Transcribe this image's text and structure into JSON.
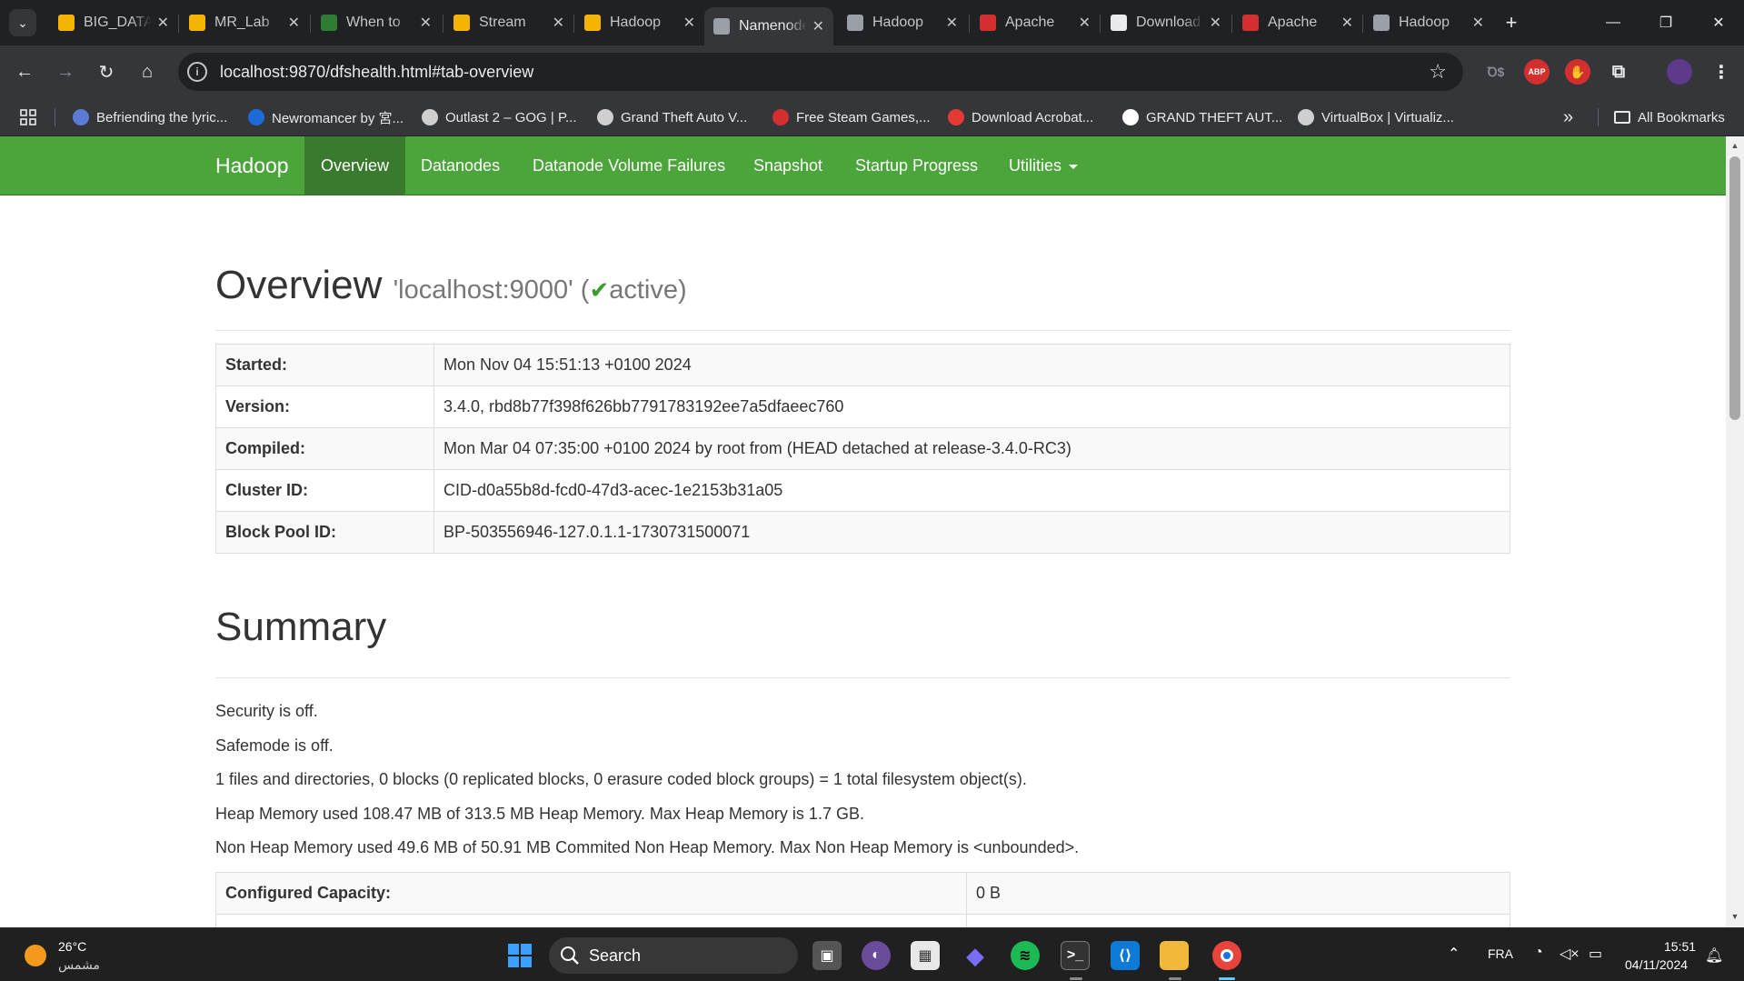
{
  "browser": {
    "tabs": [
      {
        "title": "BIG_DATA",
        "icon": "slides-icon",
        "color": "#f4b400",
        "active": false
      },
      {
        "title": "MR_Lab",
        "icon": "slides-icon",
        "color": "#f4b400",
        "active": false
      },
      {
        "title": "When to",
        "icon": "link-icon",
        "color": "#2e7d32",
        "active": false
      },
      {
        "title": "Stream",
        "icon": "classroom-icon",
        "color": "#f4b400",
        "active": false
      },
      {
        "title": "Hadoop",
        "icon": "slides-icon",
        "color": "#f4b400",
        "active": false
      },
      {
        "title": "Namenode",
        "icon": "globe-icon",
        "color": "#9aa0a6",
        "active": true
      },
      {
        "title": "Hadoop",
        "icon": "chatgpt-icon",
        "color": "#9aa0a6",
        "active": false
      },
      {
        "title": "Apache",
        "icon": "apache-feather-icon",
        "color": "#d32f2f",
        "active": false
      },
      {
        "title": "Download",
        "icon": "download-icon",
        "color": "#e8eaed",
        "active": false
      },
      {
        "title": "Apache",
        "icon": "apache-feather-icon",
        "color": "#d32f2f",
        "active": false
      },
      {
        "title": "Hadoop",
        "icon": "chatgpt-icon",
        "color": "#9aa0a6",
        "active": false
      }
    ],
    "url": "localhost:9870/dfshealth.html#tab-overview",
    "extensions": [
      {
        "name": "translate-extension-icon",
        "label": "Ꝺ$"
      },
      {
        "name": "adblock-plus-icon",
        "label": "ABP"
      },
      {
        "name": "ublock-hand-icon",
        "label": "✋"
      },
      {
        "name": "puzzle-extensions-icon",
        "label": "⧉"
      }
    ],
    "bookmarks": [
      {
        "label": "Befriending the lyric...",
        "color": "#5b7bd5"
      },
      {
        "label": "Newromancer by 宮...",
        "color": "#1e6ad8"
      },
      {
        "label": "Outlast 2 – GOG | P...",
        "color": "#cfcfcf"
      },
      {
        "label": "Grand Theft Auto V...",
        "color": "#cfcfcf"
      },
      {
        "label": "Free Steam Games,...",
        "color": "#d32f2f"
      },
      {
        "label": "Download Acrobat...",
        "color": "#e53935"
      },
      {
        "label": "GRAND THEFT AUT...",
        "color": "#ffffff"
      },
      {
        "label": "VirtualBox | Virtualiz...",
        "color": "#cfcfcf"
      }
    ],
    "more_bookmarks": "»",
    "all_bookmarks": "All Bookmarks"
  },
  "page": {
    "nav": {
      "brand": "Hadoop",
      "items": [
        "Overview",
        "Datanodes",
        "Datanode Volume Failures",
        "Snapshot",
        "Startup Progress",
        "Utilities"
      ],
      "active": "Overview"
    },
    "overview": {
      "title": "Overview",
      "host": "'localhost:9000' (",
      "check": "✔",
      "status": "active)",
      "rows": [
        {
          "key": "Started:",
          "value": "Mon Nov 04 15:51:13 +0100 2024"
        },
        {
          "key": "Version:",
          "value": "3.4.0, rbd8b77f398f626bb7791783192ee7a5dfaeec760"
        },
        {
          "key": "Compiled:",
          "value": "Mon Mar 04 07:35:00 +0100 2024 by root from (HEAD detached at release-3.4.0-RC3)"
        },
        {
          "key": "Cluster ID:",
          "value": "CID-d0a55b8d-fcd0-47d3-acec-1e2153b31a05"
        },
        {
          "key": "Block Pool ID:",
          "value": "BP-503556946-127.0.1.1-1730731500071"
        }
      ]
    },
    "summary": {
      "title": "Summary",
      "lines": [
        "Security is off.",
        "Safemode is off.",
        "1 files and directories, 0 blocks (0 replicated blocks, 0 erasure coded block groups) = 1 total filesystem object(s).",
        "Heap Memory used 108.47 MB of 313.5 MB Heap Memory. Max Heap Memory is 1.7 GB.",
        "Non Heap Memory used 49.6 MB of 50.91 MB Commited Non Heap Memory. Max Non Heap Memory is <unbounded>."
      ],
      "table": [
        {
          "key": "Configured Capacity:",
          "value": "0 B"
        }
      ]
    }
  },
  "taskbar": {
    "weather_temp": "26°C",
    "weather_desc": "مشمس",
    "search_label": "Search",
    "language": "FRA",
    "time": "15:51",
    "date": "04/11/2024",
    "apps": [
      "windows-start-icon",
      "task-view-icon",
      "tor-browser-icon",
      "microsoft-store-icon",
      "media-player-icon",
      "spotify-icon",
      "terminal-icon",
      "vscode-icon",
      "file-explorer-icon",
      "chrome-icon"
    ]
  }
}
